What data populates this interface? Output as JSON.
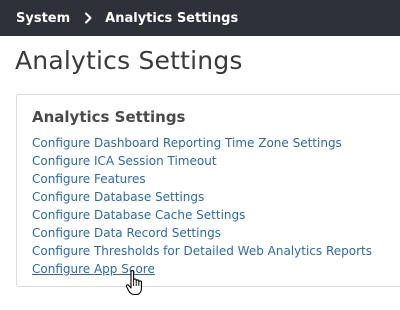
{
  "breadcrumb": {
    "items": [
      "System",
      "Analytics Settings"
    ],
    "separator_icon": "chevron-right-icon"
  },
  "page": {
    "title": "Analytics Settings"
  },
  "panel": {
    "title": "Analytics Settings",
    "links": [
      "Configure Dashboard Reporting Time Zone Settings",
      "Configure ICA Session Timeout",
      "Configure Features",
      "Configure Database Settings",
      "Configure Database Cache Settings",
      "Configure Data Record Settings",
      "Configure Thresholds for Detailed Web Analytics Reports",
      "Configure App Score"
    ],
    "hovered_link_index": 7
  },
  "colors": {
    "topbar_bg": "#2e3138",
    "link": "#2a6ab5",
    "title_text": "#3a3a3a"
  },
  "cursor_icon": "hand-pointer-icon"
}
